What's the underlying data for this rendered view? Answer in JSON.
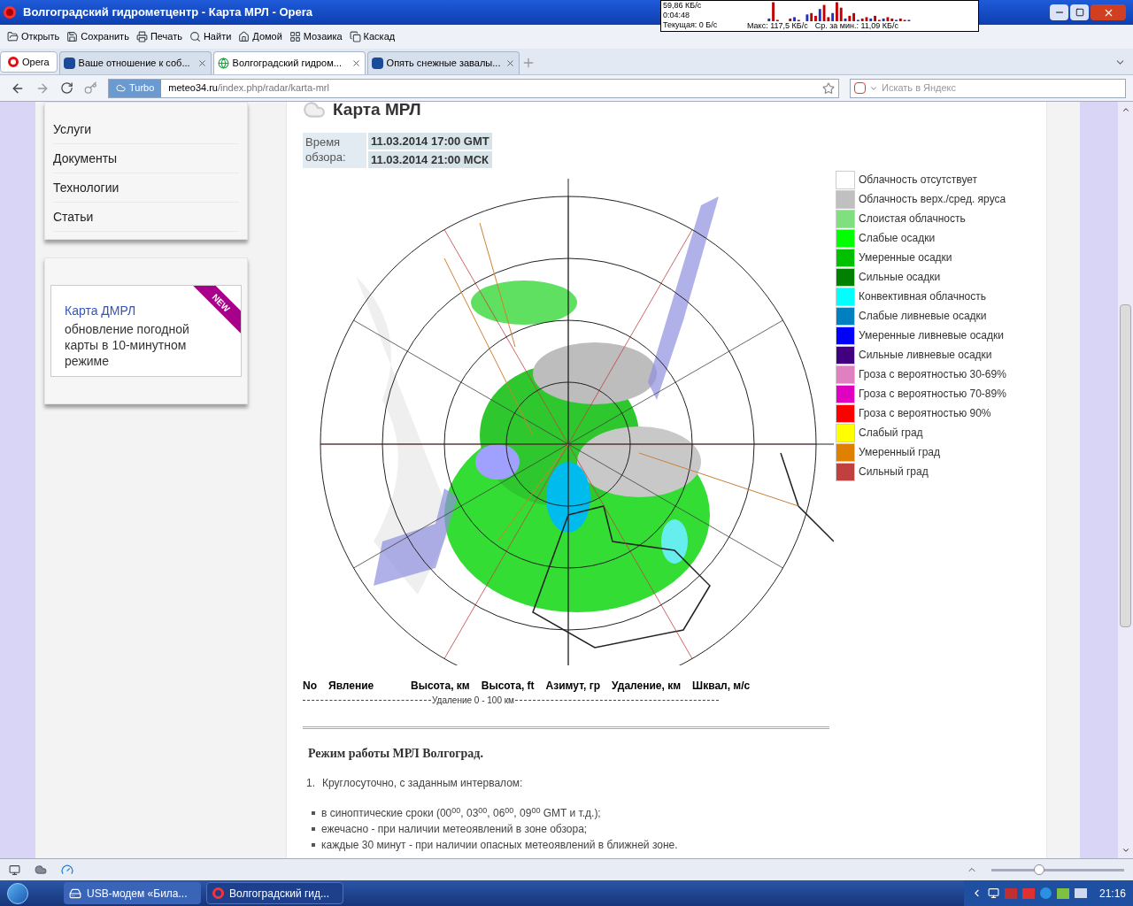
{
  "window": {
    "title": "Волгоградский гидрометцентр - Карта МРЛ - Opera"
  },
  "net_meter": {
    "speed": "59,86 КБ/с",
    "time": "0:04:48",
    "current": "Текущая: 0 Б/с",
    "max": "Макс: 117,5 КБ/с",
    "avg": "Ср. за мин.: 11,09 КБ/с"
  },
  "toolbar": [
    {
      "kind": "folder",
      "label": "Открыть"
    },
    {
      "kind": "save",
      "label": "Сохранить"
    },
    {
      "kind": "print",
      "label": "Печать"
    },
    {
      "kind": "search",
      "label": "Найти"
    },
    {
      "kind": "home",
      "label": "Домой"
    },
    {
      "kind": "grid",
      "label": "Мозаика"
    },
    {
      "kind": "cascade",
      "label": "Каскад"
    }
  ],
  "menu_button": "Opera",
  "tabs": [
    {
      "kind": "site",
      "label": "Ваше отношение к соб...",
      "selected": false
    },
    {
      "kind": "globe",
      "label": "Волгоградский гидром...",
      "selected": true
    },
    {
      "kind": "site",
      "label": "Опять снежные завалы...",
      "selected": false
    }
  ],
  "address": {
    "turbo": "Turbo",
    "host": "meteo34.ru",
    "path": "/index.php/radar/karta-mrl",
    "search_placeholder": "Искать в Яндекс"
  },
  "sidebar": {
    "items": [
      "Услуги",
      "Документы",
      "Технологии",
      "Статьи"
    ],
    "promo": {
      "link": "Карта ДМРЛ",
      "text": "обновление погодной карты в 10-минутном режиме",
      "badge": "NEW"
    }
  },
  "page": {
    "title": "Карта МРЛ",
    "time_label": "Время обзора:",
    "times": [
      "11.03.2014 17:00 GMT",
      "11.03.2014 21:00 МСК"
    ]
  },
  "legend": [
    {
      "label": "Облачность отсутствует",
      "color": "#ffffff"
    },
    {
      "label": "Облачность верх./сред. яруса",
      "color": "#c0c0c0"
    },
    {
      "label": "Слоистая облачность",
      "color": "#80e080"
    },
    {
      "label": "Слабые осадки",
      "color": "#00ff00"
    },
    {
      "label": "Умеренные осадки",
      "color": "#00c000"
    },
    {
      "label": "Сильные осадки",
      "color": "#008000"
    },
    {
      "label": "Конвективная облачность",
      "color": "#00ffff"
    },
    {
      "label": "Слабые ливневые осадки",
      "color": "#0080c0"
    },
    {
      "label": "Умеренные ливневые осадки",
      "color": "#0000ff"
    },
    {
      "label": "Сильные ливневые осадки",
      "color": "#400080"
    },
    {
      "label": "Гроза с вероятностью 30-69%",
      "color": "#e080c0"
    },
    {
      "label": "Гроза с вероятностью 70-89%",
      "color": "#e000c0"
    },
    {
      "label": "Гроза с вероятностью 90%",
      "color": "#ff0000"
    },
    {
      "label": "Слабый град",
      "color": "#ffff00"
    },
    {
      "label": "Умеренный град",
      "color": "#e08000"
    },
    {
      "label": "Сильный град",
      "color": "#c04040"
    }
  ],
  "phenomena_table": {
    "columns": [
      "No",
      "Явление",
      "Высота, км",
      "Высота, ft",
      "Азимут, гр",
      "Удаление, км",
      "Шквал, м/с"
    ],
    "range_row": "Удаление 0 - 100 км"
  },
  "schedule": {
    "heading": "Режим работы МРЛ Волгоград.",
    "item_number": "1.",
    "item": "Круглосуточно, с заданным интервалом:",
    "bullets": [
      "в синоптические сроки (00$^{00}$, 03$^{00}$, 06$^{00}$, 09$^{00}$ GMT и т.д.);",
      "ежечасно - при наличии метеоявлений в зоне обзора;",
      "каждые 30 минут - при наличии опасных метеоявлений в ближней зоне."
    ]
  },
  "zoom": {
    "level": 0.35
  },
  "taskbar": {
    "tasks": [
      {
        "kind": "modem",
        "label": "USB-модем «Била...",
        "selected": false
      },
      {
        "kind": "opera",
        "label": "Волгоградский гид...",
        "selected": true
      }
    ],
    "clock": "21:16"
  }
}
